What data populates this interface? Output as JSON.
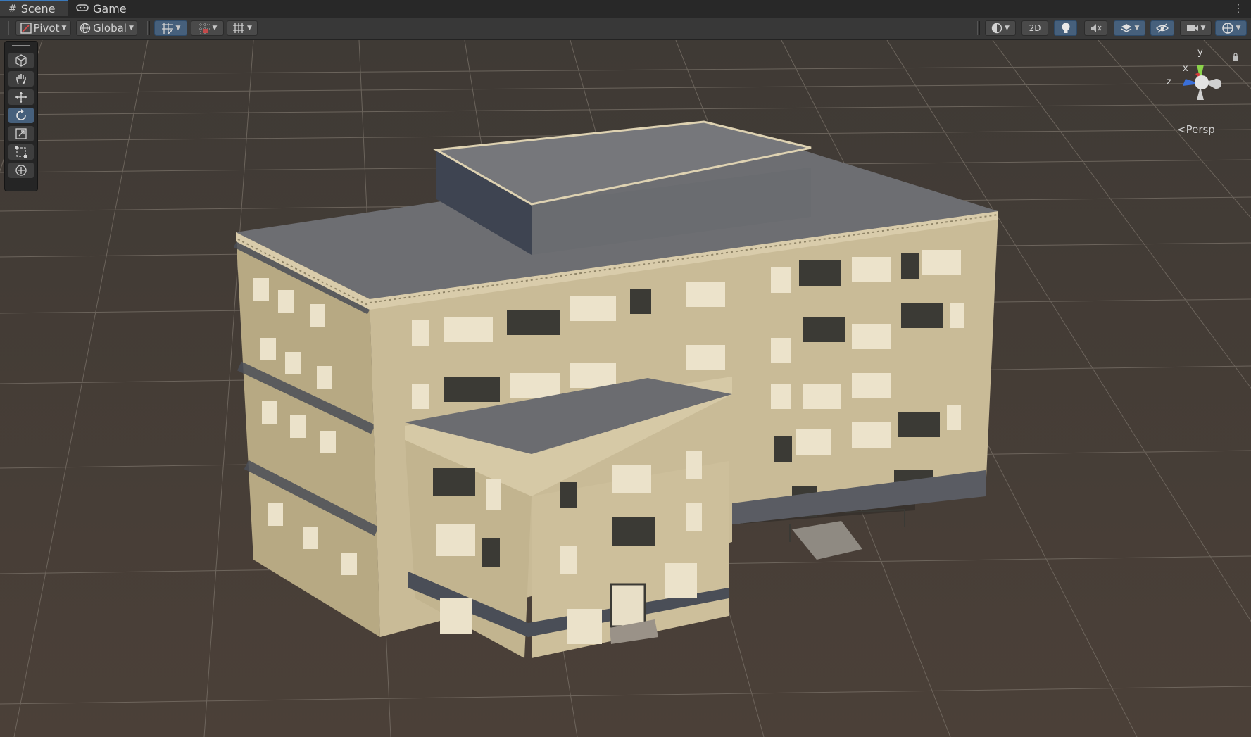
{
  "tabs": [
    {
      "label": "Scene",
      "icon": "hash-icon",
      "active": true
    },
    {
      "label": "Game",
      "icon": "gamepad-icon",
      "active": false
    }
  ],
  "toolbar": {
    "pivot_label": "Pivot",
    "global_label": "Global",
    "twod_label": "2D"
  },
  "tools": [
    "view-tool",
    "hand-tool",
    "move-tool",
    "rotate-tool",
    "scale-tool",
    "rect-tool",
    "transform-tool"
  ],
  "active_tool": "rotate-tool",
  "gizmo": {
    "axis_x": "x",
    "axis_y": "y",
    "axis_z": "z",
    "projection_label": "Persp"
  },
  "colors": {
    "accent": "#46607c",
    "axis_x": "#d33a3a",
    "axis_y": "#8bd34a",
    "axis_z": "#3a6fd8",
    "ground": "#4a4038",
    "facade": "#c9bb97"
  }
}
